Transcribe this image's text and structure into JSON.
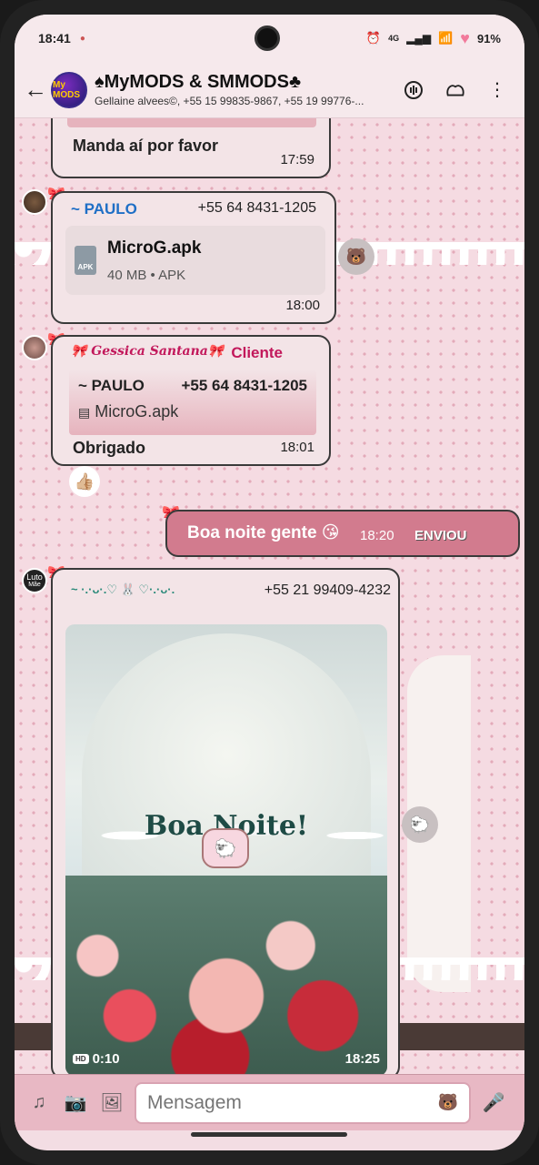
{
  "status_bar": {
    "time": "18:41",
    "signal": "4G",
    "battery": "91%"
  },
  "header": {
    "avatar_text": "My MODS",
    "title": "♠MyMODS & SMMODS♣",
    "members": "Gellaine alvees©, +55 15 99835-9867, +55 19 99776-..."
  },
  "messages": {
    "m0": {
      "text": "Manda aí por favor",
      "time": "17:59"
    },
    "m1": {
      "sender": "~ PAULO",
      "phone": "+55 64 8431-1205",
      "file_name": "MicroG.apk",
      "file_meta": "40 MB • APK",
      "file_type": "APK",
      "time": "18:00"
    },
    "m2": {
      "sender": "🎀 Gessica Santana🎀",
      "role": "Cliente",
      "quote_sender": "~ PAULO",
      "quote_phone": "+55 64 8431-1205",
      "quote_file": "MicroG.apk",
      "text": "Obrigado",
      "time": "18:01",
      "reaction": "👍🏼"
    },
    "m3": {
      "text": "Boa noite gente 😘",
      "time": "18:20",
      "tag": "ENVIOU"
    },
    "m4": {
      "sender": "~ ·.·ᴗ·.♡ 🐰 ♡·.·ᴗ·.",
      "phone": "+55 21 99409-4232",
      "video_text": "Boa Noite!",
      "hd": "HD",
      "duration": "0:10",
      "time": "18:25",
      "luto_label": "Luto",
      "mae_label": "Mãe"
    }
  },
  "input": {
    "placeholder": "Mensagem"
  },
  "colors": {
    "accent": "#d27b8e",
    "bubble": "#f3e4e7",
    "background": "#f5dbe2"
  }
}
